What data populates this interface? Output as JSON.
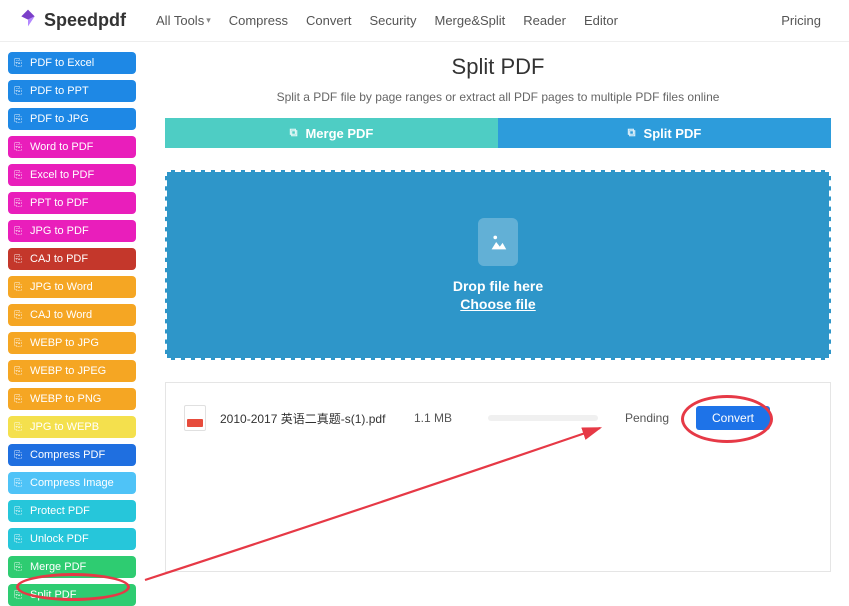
{
  "header": {
    "brand": "Speedpdf",
    "nav": {
      "all_tools": "All Tools",
      "compress": "Compress",
      "convert": "Convert",
      "security": "Security",
      "merge_split": "Merge&Split",
      "reader": "Reader",
      "editor": "Editor"
    },
    "pricing": "Pricing"
  },
  "sidebar": {
    "items": [
      {
        "label": "PDF to Excel",
        "bg": "#1e88e5"
      },
      {
        "label": "PDF to PPT",
        "bg": "#1e88e5"
      },
      {
        "label": "PDF to JPG",
        "bg": "#1e88e5"
      },
      {
        "label": "Word to PDF",
        "bg": "#e91ebb"
      },
      {
        "label": "Excel to PDF",
        "bg": "#e91ebb"
      },
      {
        "label": "PPT to PDF",
        "bg": "#e91ebb"
      },
      {
        "label": "JPG to PDF",
        "bg": "#e91ebb"
      },
      {
        "label": "CAJ to PDF",
        "bg": "#c4372b"
      },
      {
        "label": "JPG to Word",
        "bg": "#f5a623"
      },
      {
        "label": "CAJ to Word",
        "bg": "#f5a623"
      },
      {
        "label": "WEBP to JPG",
        "bg": "#f5a623"
      },
      {
        "label": "WEBP to JPEG",
        "bg": "#f5a623"
      },
      {
        "label": "WEBP to PNG",
        "bg": "#f5a623"
      },
      {
        "label": "JPG to WEPB",
        "bg": "#f4e04d",
        "fg": "#fff"
      },
      {
        "label": "Compress PDF",
        "bg": "#1f6fe0"
      },
      {
        "label": "Compress Image",
        "bg": "#4fc3f7"
      },
      {
        "label": "Protect PDF",
        "bg": "#26c6da"
      },
      {
        "label": "Unlock PDF",
        "bg": "#26c6da"
      },
      {
        "label": "Merge PDF",
        "bg": "#2ecc71"
      },
      {
        "label": "Split PDF",
        "bg": "#2ecc71"
      }
    ]
  },
  "page": {
    "title": "Split PDF",
    "description": "Split a PDF file by page ranges or extract all PDF pages to multiple PDF files online"
  },
  "tabs": {
    "merge": "Merge PDF",
    "split": "Split PDF"
  },
  "dropzone": {
    "drop_text": "Drop file here",
    "choose_text": "Choose file"
  },
  "file": {
    "name": "2010-2017 英语二真题-s(1).pdf",
    "size": "1.1 MB",
    "status": "Pending",
    "convert_label": "Convert"
  }
}
